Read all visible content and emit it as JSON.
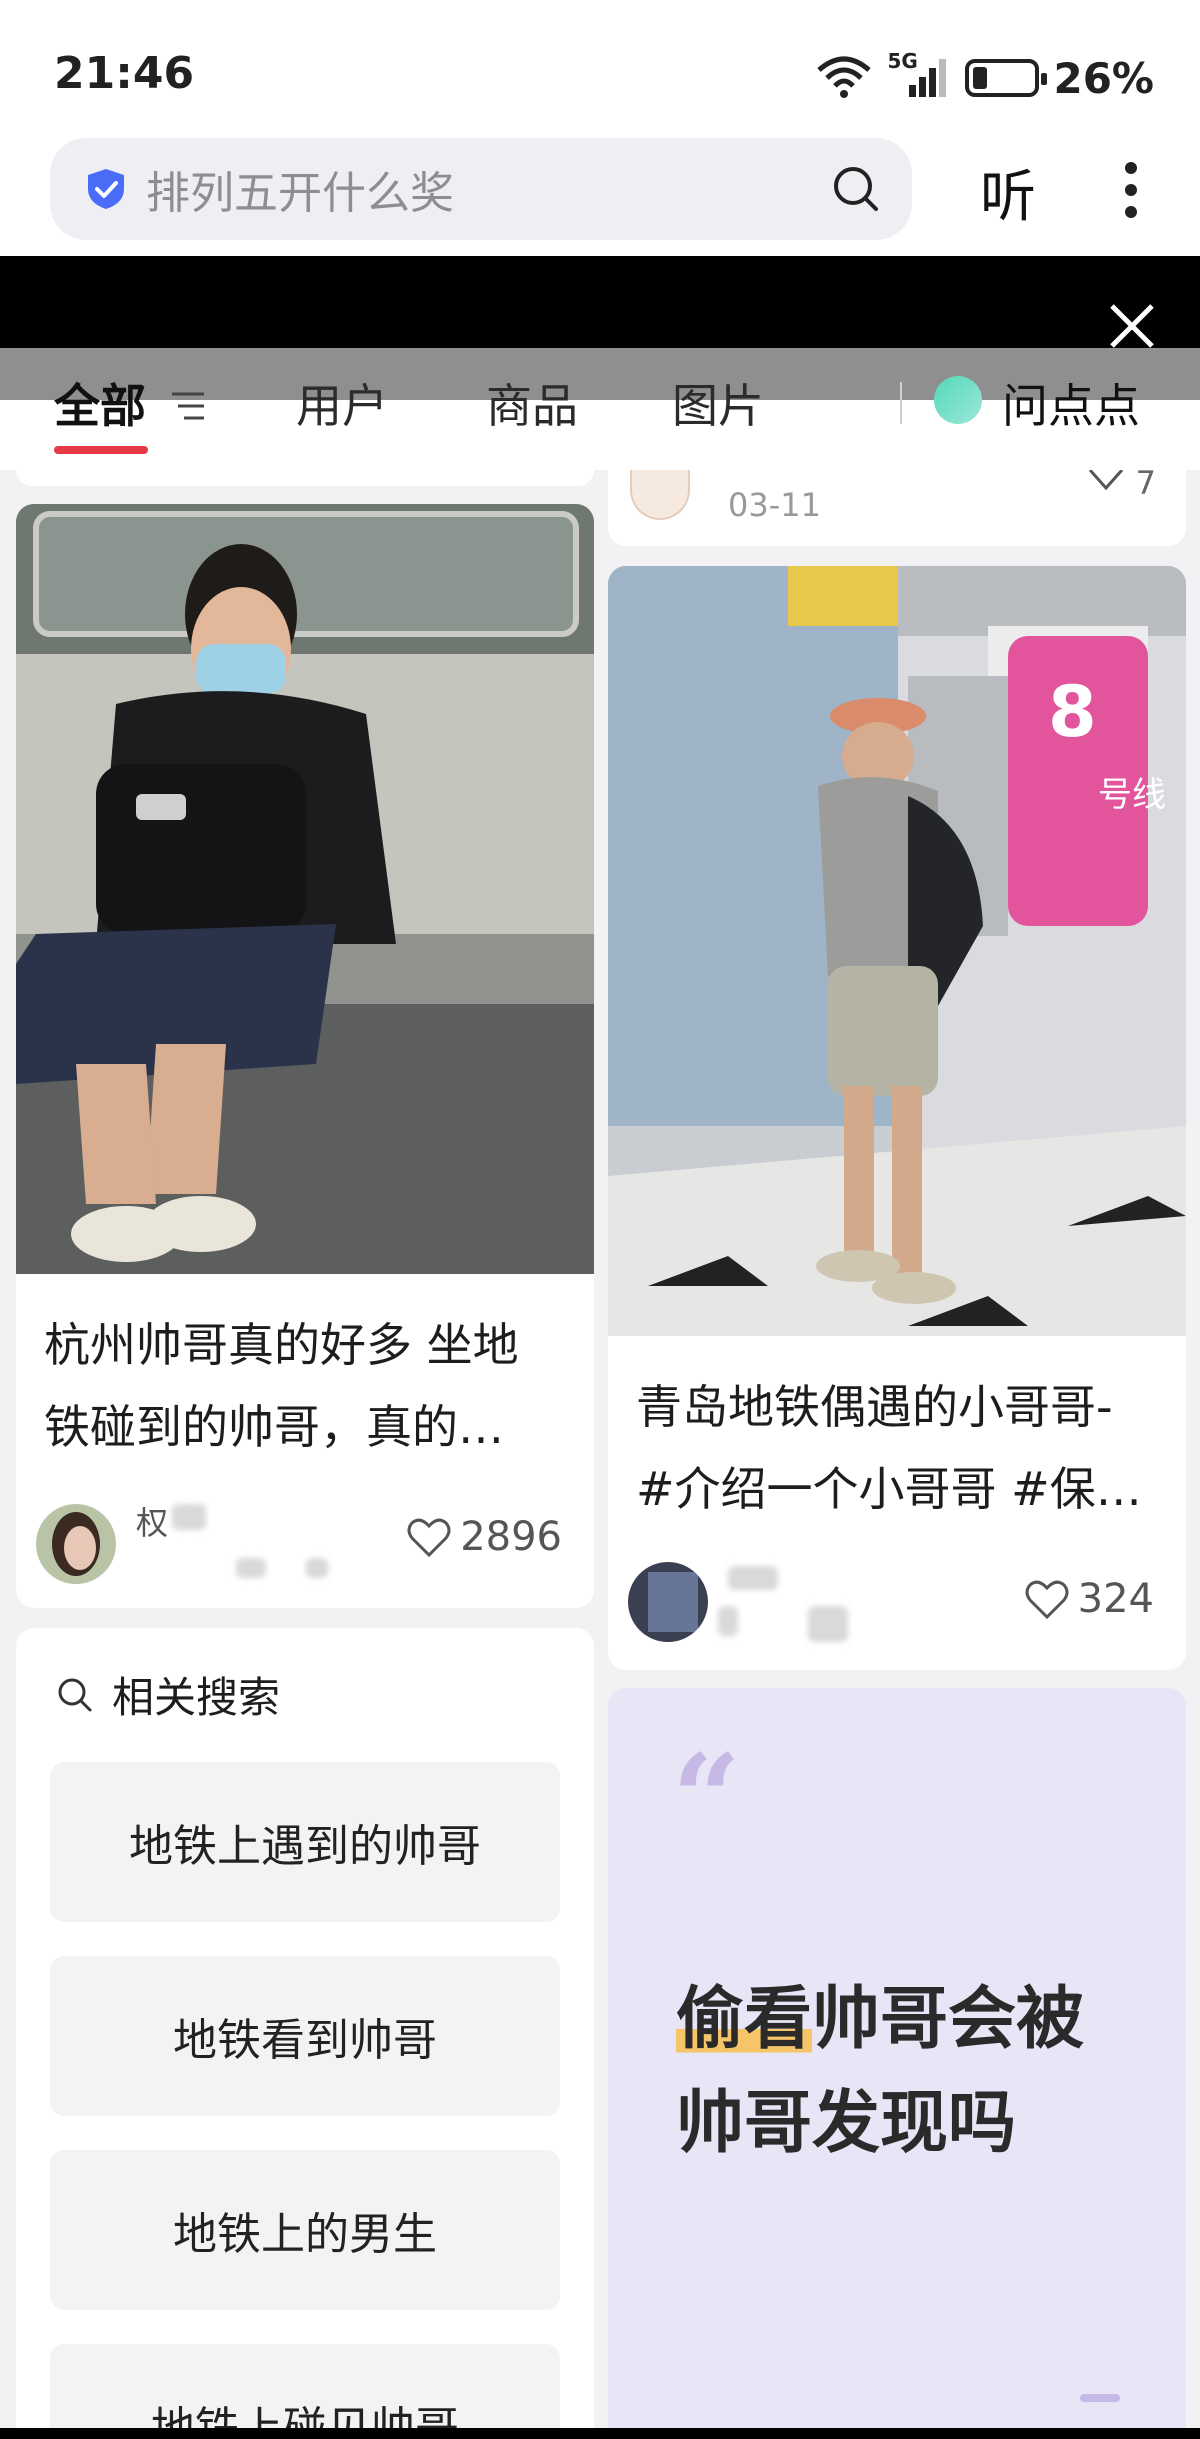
{
  "status_bar": {
    "time": "21:46",
    "network": "5G",
    "battery_percent": "26%",
    "battery_level": 0.26
  },
  "search": {
    "placeholder": "排列五开什么奖",
    "listen_label": "听"
  },
  "tabs": [
    {
      "label": "全部",
      "active": true
    },
    {
      "label": "用户"
    },
    {
      "label": "商品"
    },
    {
      "label": "图片"
    }
  ],
  "ask_label": "问点点",
  "feed": {
    "right_top_stub": {
      "date": "03-11",
      "likes": "7"
    },
    "left_post": {
      "title_line1": "杭州帅哥真的好多 坐地",
      "title_line2": "铁碰到的帅哥，真的…",
      "author_partial": "权",
      "likes": "2896"
    },
    "right_post": {
      "title_line1": "青岛地铁偶遇的小哥哥-",
      "title_line2": "#介绍一个小哥哥 #保…",
      "likes": "324",
      "sign_number": "8",
      "sign_text": "号线"
    },
    "related": {
      "title": "相关搜索",
      "items": [
        "地铁上遇到的帅哥",
        "地铁看到帅哥",
        "地铁上的男生",
        "地铁上碰见帅哥"
      ]
    },
    "qa_card": {
      "quote": "“",
      "highlight": "偷看",
      "text_rest_line1": "帅哥会被",
      "text_line2": "帅哥发现吗"
    }
  },
  "colors": {
    "accent_red": "#e63946",
    "qa_background": "#e8e6f6",
    "highlight": "#f6c56a"
  }
}
